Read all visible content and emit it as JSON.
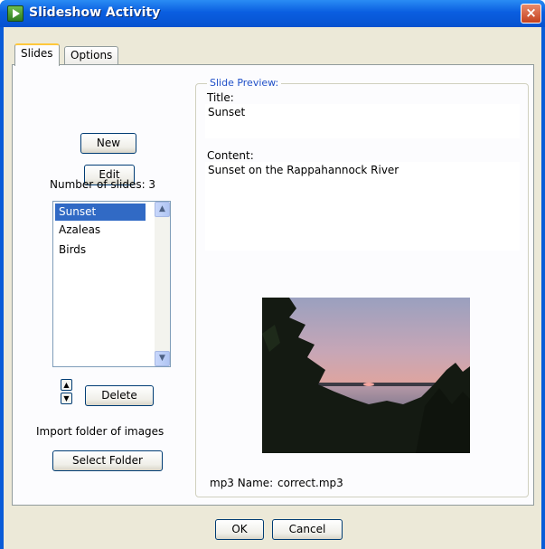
{
  "window": {
    "title": "Slideshow Activity",
    "close_glyph": "×"
  },
  "tabs": [
    {
      "label": "Slides",
      "active": true
    },
    {
      "label": "Options",
      "active": false
    }
  ],
  "slides_panel": {
    "new_button": "New",
    "edit_button": "Edit",
    "count_label": "Number of slides: 3",
    "slides": [
      "Sunset",
      "Azaleas",
      "Birds"
    ],
    "selected_index": 0,
    "delete_button": "Delete",
    "import_label": "Import folder of images",
    "select_folder_button": "Select Folder"
  },
  "preview": {
    "group_label": "Slide Preview:",
    "title_label": "Title:",
    "title_value": "Sunset",
    "content_label": "Content:",
    "content_value": "Sunset on the Rappahannock River",
    "mp3_label": "mp3 Name:",
    "mp3_value": "correct.mp3"
  },
  "footer": {
    "ok_button": "OK",
    "cancel_button": "Cancel"
  },
  "colors": {
    "titlebar": "#0a5ee0",
    "selection": "#316ac5",
    "group_legend": "#2050c8"
  },
  "icons": [
    "app-icon",
    "close-icon",
    "scroll-up-arrow-icon",
    "scroll-down-arrow-icon",
    "move-up-icon",
    "move-down-icon"
  ]
}
